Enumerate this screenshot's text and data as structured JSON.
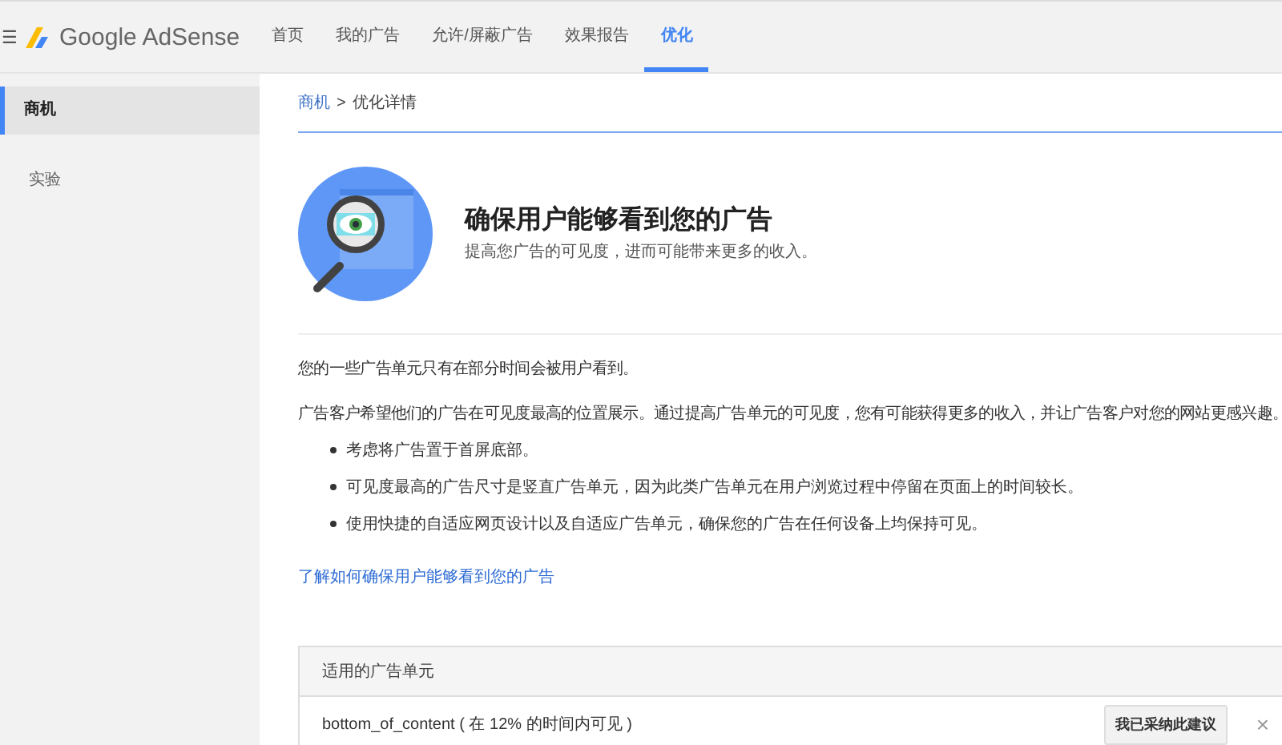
{
  "header": {
    "menu_glyph": "☰",
    "logo_text": "Google AdSense",
    "tabs": [
      {
        "label": "首页",
        "selected": false
      },
      {
        "label": "我的广告",
        "selected": false
      },
      {
        "label": "允许/屏蔽广告",
        "selected": false
      },
      {
        "label": "效果报告",
        "selected": false
      },
      {
        "label": "优化",
        "selected": true
      }
    ]
  },
  "sidebar": {
    "items": [
      {
        "label": "商机",
        "selected": true
      },
      {
        "label": "实验",
        "selected": false
      }
    ]
  },
  "breadcrumb": {
    "parent": "商机",
    "separator": ">",
    "current": "优化详情"
  },
  "hero": {
    "title": "确保用户能够看到您的广告",
    "subtitle": "提高您广告的可见度，进而可能带来更多的收入。"
  },
  "paragraphs": [
    "您的一些广告单元只有在部分时间会被用户看到。",
    "广告客户希望他们的广告在可见度最高的位置展示。通过提高广告单元的可见度，您有可能获得更多的收入，并让广告客户对您的网站更感兴趣。"
  ],
  "bullets": [
    "考虑将广告置于首屏底部。",
    "可见度最高的广告尺寸是竖直广告单元，因为此类广告单元在用户浏览过程中停留在页面上的时间较长。",
    "使用快捷的自适应网页设计以及自适应广告单元，确保您的广告在任何设备上均保持可见。"
  ],
  "link": "了解如何确保用户能够看到您的广告",
  "units_card": {
    "header": "适用的广告单元",
    "rows": [
      {
        "name": "bottom_of_content ( 在 12% 的时间内可见 )",
        "button": "我已采纳此建议",
        "dismiss_glyph": "×"
      }
    ]
  }
}
